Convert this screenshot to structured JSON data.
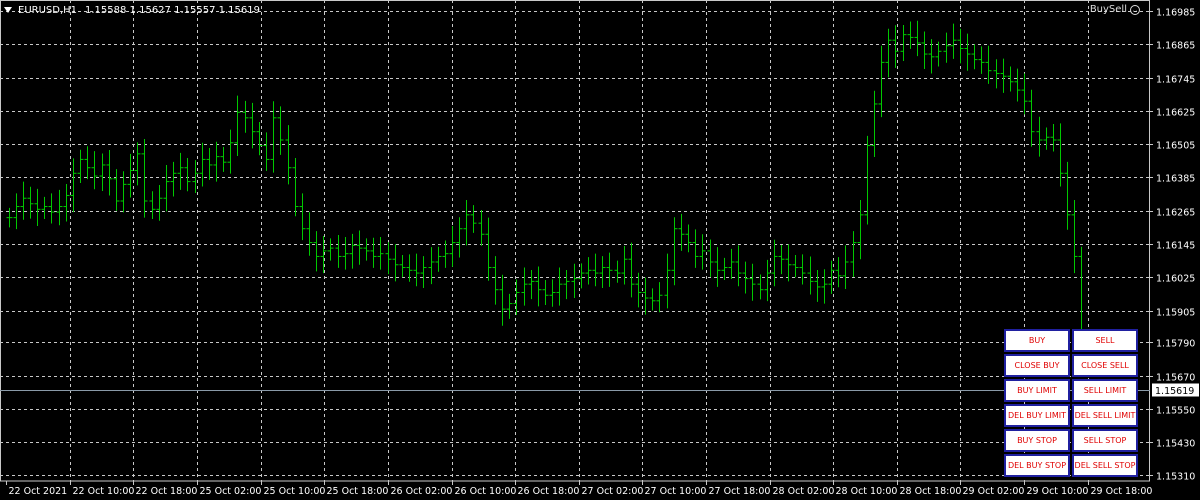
{
  "header": {
    "symbol": "EURUSD,H1",
    "ohlc": "1.15588 1.15627 1.15557 1.15619"
  },
  "ea_label": "BuySell",
  "icons": {
    "dropdown": "triangle-down-icon",
    "ea_status": "smiley-face-icon"
  },
  "colors": {
    "background": "#000000",
    "grid": "#c8c8c8",
    "candle": "#00c800",
    "axis_text": "#ffffff",
    "button_text": "#e00000",
    "button_border": "#2020a0"
  },
  "chart_data": {
    "type": "ohlc",
    "symbol": "EURUSD",
    "timeframe": "H1",
    "ylim": [
      1.1529,
      1.17025
    ],
    "y_ticks": [
      "1.16985",
      "1.16865",
      "1.16745",
      "1.16625",
      "1.16505",
      "1.16385",
      "1.16265",
      "1.16145",
      "1.16025",
      "1.15905",
      "1.15790",
      "1.15670",
      "1.15550",
      "1.15430",
      "1.15310"
    ],
    "x_ticks": [
      "22 Oct 2021",
      "22 Oct 10:00",
      "22 Oct 18:00",
      "25 Oct 02:00",
      "25 Oct 10:00",
      "25 Oct 18:00",
      "26 Oct 02:00",
      "26 Oct 10:00",
      "26 Oct 18:00",
      "27 Oct 02:00",
      "27 Oct 10:00",
      "27 Oct 18:00",
      "28 Oct 02:00",
      "28 Oct 10:00",
      "28 Oct 18:00",
      "29 Oct 02:00",
      "29 Oct 10:00",
      "29 Oct 18:00"
    ],
    "current_price": "1.15619",
    "closes": [
      1.1624,
      1.1628,
      1.1631,
      1.1629,
      1.1627,
      1.1628,
      1.1626,
      1.1628,
      1.1632,
      1.164,
      1.1645,
      1.1642,
      1.1639,
      1.1643,
      1.1638,
      1.163,
      1.1636,
      1.1641,
      1.1647,
      1.163,
      1.1627,
      1.1631,
      1.1637,
      1.164,
      1.1642,
      1.1637,
      1.164,
      1.1645,
      1.1643,
      1.1646,
      1.1644,
      1.1651,
      1.1662,
      1.166,
      1.1655,
      1.165,
      1.1645,
      1.166,
      1.1652,
      1.1642,
      1.1628,
      1.162,
      1.1615,
      1.161,
      1.1612,
      1.1613,
      1.161,
      1.1611,
      1.1614,
      1.1613,
      1.1612,
      1.161,
      1.1611,
      1.1609,
      1.1607,
      1.1606,
      1.1605,
      1.1604,
      1.1606,
      1.1608,
      1.161,
      1.1611,
      1.1615,
      1.162,
      1.1625,
      1.1622,
      1.1618,
      1.1606,
      1.1598,
      1.1591,
      1.1593,
      1.1597,
      1.16,
      1.1601,
      1.1598,
      1.1596,
      1.1597,
      1.16,
      1.1601,
      1.1602,
      1.1604,
      1.1605,
      1.1604,
      1.1606,
      1.1605,
      1.1604,
      1.1609,
      1.16,
      1.1597,
      1.1595,
      1.1594,
      1.1596,
      1.1605,
      1.162,
      1.1618,
      1.1615,
      1.161,
      1.1612,
      1.1608,
      1.1605,
      1.1606,
      1.1608,
      1.1604,
      1.1602,
      1.16,
      1.1598,
      1.1604,
      1.161,
      1.1609,
      1.1607,
      1.1606,
      1.1604,
      1.1601,
      1.1599,
      1.16,
      1.1605,
      1.1603,
      1.1608,
      1.1615,
      1.1625,
      1.165,
      1.1665,
      1.168,
      1.1688,
      1.1684,
      1.169,
      1.1689,
      1.1687,
      1.1683,
      1.1682,
      1.1684,
      1.1686,
      1.1688,
      1.1685,
      1.1683,
      1.1681,
      1.168,
      1.1677,
      1.1676,
      1.1675,
      1.1673,
      1.167,
      1.1666,
      1.1655,
      1.1652,
      1.1653,
      1.1652,
      1.164,
      1.1625,
      1.161,
      1.158
    ]
  },
  "buttons": [
    {
      "left": "BUY",
      "right": "SELL"
    },
    {
      "left": "CLOSE BUY",
      "right": "CLOSE SELL"
    },
    {
      "left": "BUY LIMIT",
      "right": "SELL LIMIT"
    },
    {
      "left": "DEL BUY LIMIT",
      "right": "DEL SELL LIMIT"
    },
    {
      "left": "BUY STOP",
      "right": "SELL STOP"
    },
    {
      "left": "DEL BUY STOP",
      "right": "DEL SELL STOP"
    }
  ]
}
